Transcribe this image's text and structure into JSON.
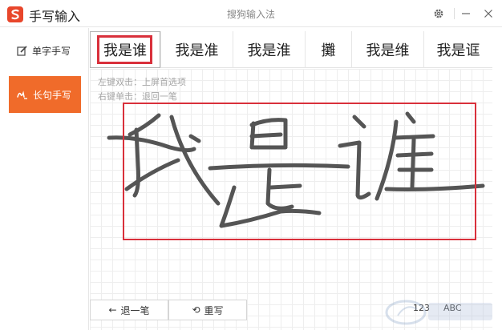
{
  "titlebar": {
    "app_title": "手写输入",
    "center_title": "搜狗输入法"
  },
  "sidebar": {
    "items": [
      {
        "label": "单字手写",
        "icon": "edit-icon",
        "active": false
      },
      {
        "label": "长句手写",
        "icon": "signature-icon",
        "active": true
      }
    ]
  },
  "candidates": [
    "我是谁",
    "我是准",
    "我是淮",
    "攤",
    "我是维",
    "我是诓"
  ],
  "selected_candidate_index": 0,
  "hints": {
    "line1": "左键双击：上屏首选项",
    "line2": "右键单击：退回一笔"
  },
  "toolbar": {
    "back_label": "退一笔",
    "rewrite_label": "重写"
  },
  "modes": {
    "num_label": "123",
    "abc_label": "ABC"
  },
  "colors": {
    "accent": "#f06b2a",
    "highlight": "#d9303b",
    "ink": "#555555"
  }
}
